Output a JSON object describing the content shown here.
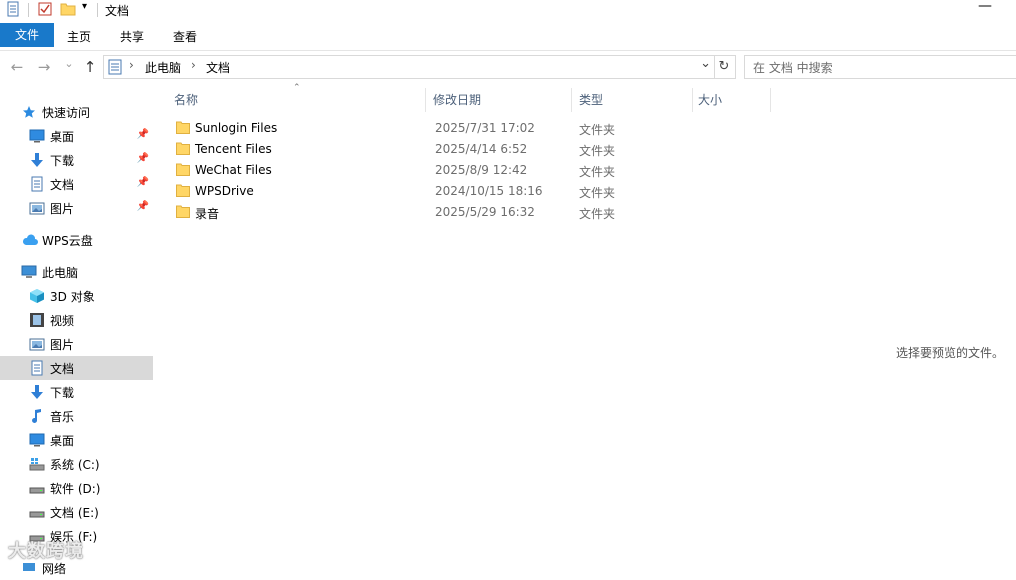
{
  "titlebar": {
    "title": "文档",
    "minimize": "—"
  },
  "ribbon": {
    "tabs": [
      "文件",
      "主页",
      "共享",
      "查看"
    ]
  },
  "nav": {
    "back": "←",
    "forward": "→",
    "recent": "⌄",
    "up": "↑"
  },
  "address": {
    "crumbs": [
      "此电脑",
      "文档"
    ],
    "sep": "›",
    "dropdown": "⌄",
    "refresh": "↻"
  },
  "search": {
    "placeholder": "在 文档 中搜索"
  },
  "sidebar": {
    "quick_access": "快速访问",
    "quick_items": [
      {
        "label": "桌面",
        "icon": "desktop-icon"
      },
      {
        "label": "下载",
        "icon": "download-icon"
      },
      {
        "label": "文档",
        "icon": "document-icon"
      },
      {
        "label": "图片",
        "icon": "picture-icon"
      }
    ],
    "wps": "WPS云盘",
    "this_pc": "此电脑",
    "pc_items": [
      {
        "label": "3D 对象",
        "icon": "cube-icon"
      },
      {
        "label": "视频",
        "icon": "video-icon"
      },
      {
        "label": "图片",
        "icon": "picture-icon"
      },
      {
        "label": "文档",
        "icon": "document-icon"
      },
      {
        "label": "下载",
        "icon": "download-icon"
      },
      {
        "label": "音乐",
        "icon": "music-icon"
      },
      {
        "label": "桌面",
        "icon": "desktop-icon"
      },
      {
        "label": "系统 (C:)",
        "icon": "system-drive-icon"
      },
      {
        "label": "软件 (D:)",
        "icon": "drive-icon"
      },
      {
        "label": "文档 (E:)",
        "icon": "drive-icon"
      },
      {
        "label": "娱乐 (F:)",
        "icon": "drive-icon"
      }
    ],
    "network": "网络"
  },
  "columns": {
    "name": "名称",
    "date": "修改日期",
    "type": "类型",
    "size": "大小"
  },
  "files": [
    {
      "name": "Sunlogin Files",
      "date": "2025/7/31 17:02",
      "type": "文件夹"
    },
    {
      "name": "Tencent Files",
      "date": "2025/4/14 6:52",
      "type": "文件夹"
    },
    {
      "name": "WeChat Files",
      "date": "2025/8/9 12:42",
      "type": "文件夹"
    },
    {
      "name": "WPSDrive",
      "date": "2024/10/15 18:16",
      "type": "文件夹"
    },
    {
      "name": "录音",
      "date": "2025/5/29 16:32",
      "type": "文件夹"
    }
  ],
  "preview": {
    "text": "选择要预览的文件。"
  },
  "watermark": "大数跨境",
  "colors": {
    "accent": "#1979ca",
    "folder": "#ffd666",
    "selected": "#d9d9d9"
  }
}
